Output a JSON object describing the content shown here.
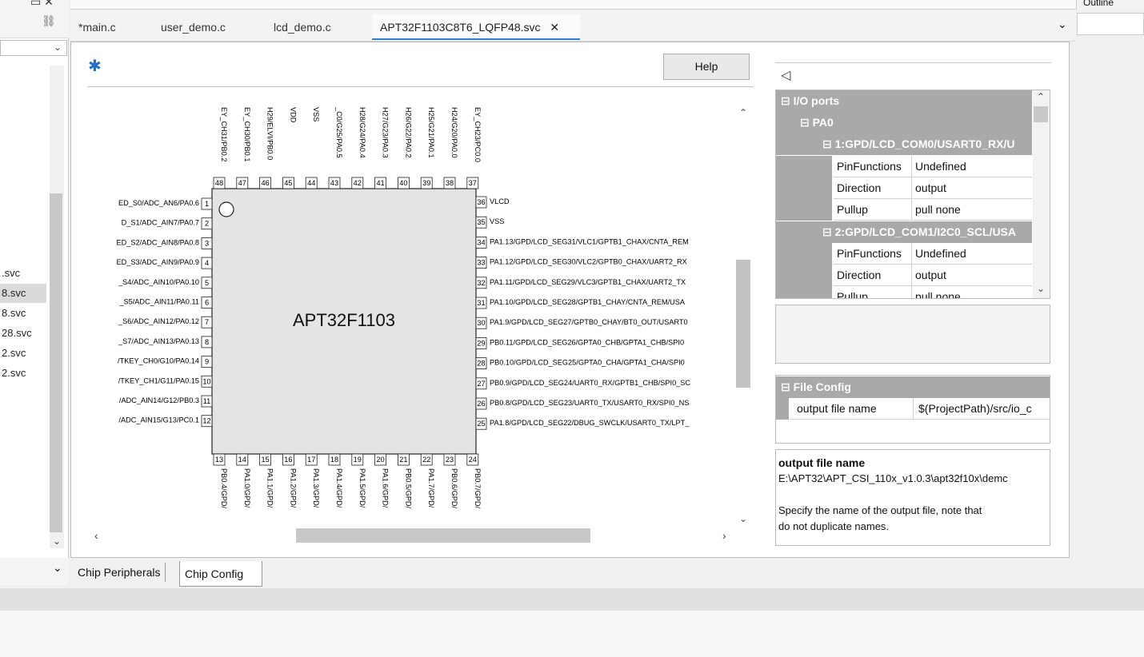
{
  "editor_tabs": [
    {
      "label": "*main.c"
    },
    {
      "label": "user_demo.c"
    },
    {
      "label": "lcd_demo.c"
    },
    {
      "label": "APT32F1103C8T6_LQFP48.svc",
      "active": true
    }
  ],
  "outline_title": "Outline",
  "left_files": [
    ".svc",
    "8.svc",
    "8.svc",
    "28.svc",
    "2.svc",
    "2.svc"
  ],
  "help_label": "Help",
  "chip": {
    "name": "APT32F1103",
    "left_pins": [
      {
        "num": "1",
        "label": "ED_S0/ADC_AN6/PA0.6"
      },
      {
        "num": "2",
        "label": "D_S1/ADC_AIN7/PA0.7"
      },
      {
        "num": "3",
        "label": "ED_S2/ADC_AIN8/PA0.8"
      },
      {
        "num": "4",
        "label": "ED_S3/ADC_AIN9/PA0.9"
      },
      {
        "num": "5",
        "label": "_S4/ADC_AIN10/PA0.10"
      },
      {
        "num": "6",
        "label": "_S5/ADC_AIN11/PA0.11"
      },
      {
        "num": "7",
        "label": "_S6/ADC_AIN12/PA0.12"
      },
      {
        "num": "8",
        "label": "_S7/ADC_AIN13/PA0.13"
      },
      {
        "num": "9",
        "label": "/TKEY_CH0/G10/PA0.14"
      },
      {
        "num": "10",
        "label": "/TKEY_CH1/G11/PA0.15"
      },
      {
        "num": "11",
        "label": "/ADC_AIN14/G12/PB0.3"
      },
      {
        "num": "12",
        "label": "/ADC_AIN15/G13/PC0.1"
      }
    ],
    "right_pins": [
      {
        "num": "36",
        "label": "VLCD"
      },
      {
        "num": "35",
        "label": "VSS"
      },
      {
        "num": "34",
        "label": "PA1.13/GPD/LCD_SEG31/VLC1/GPTB1_CHAX/CNTA_REM"
      },
      {
        "num": "33",
        "label": "PA1.12/GPD/LCD_SEG30/VLC2/GPTB0_CHAX/UART2_RX"
      },
      {
        "num": "32",
        "label": "PA1.11/GPD/LCD_SEG29/VLC3/GPTB1_CHAX/UART2_TX"
      },
      {
        "num": "31",
        "label": "PA1.10/GPD/LCD_SEG28/GPTB1_CHAY/CNTA_REM/USA"
      },
      {
        "num": "30",
        "label": "PA1.9/GPD/LCD_SEG27/GPTB0_CHAY/BT0_OUT/USART0"
      },
      {
        "num": "29",
        "label": "PB0.11/GPD/LCD_SEG26/GPTA0_CHB/GPTA1_CHB/SPI0"
      },
      {
        "num": "28",
        "label": "PB0.10/GPD/LCD_SEG25/GPTA0_CHA/GPTA1_CHA/SPI0"
      },
      {
        "num": "27",
        "label": "PB0.9/GPD/LCD_SEG24/UART0_RX/GPTB1_CHB/SPI0_SC"
      },
      {
        "num": "26",
        "label": "PB0.8/GPD/LCD_SEG23/UART0_TX/USART0_RX/SPI0_NS"
      },
      {
        "num": "25",
        "label": "PA1.8/GPD/LCD_SEG22/DBUG_SWCLK/USART0_TX/LPT_"
      }
    ],
    "top_pins": [
      {
        "num": "48",
        "label": "EY_CH31/PB0.2"
      },
      {
        "num": "47",
        "label": "EY_CH30/PB0.1"
      },
      {
        "num": "46",
        "label": "H29/ELVI/PB0.0"
      },
      {
        "num": "45",
        "label": "VDD"
      },
      {
        "num": "44",
        "label": "VSS"
      },
      {
        "num": "43",
        "label": "_C0/G25/PA0.5"
      },
      {
        "num": "42",
        "label": "H28/G24/PA0.4"
      },
      {
        "num": "41",
        "label": "H27/G23/PA0.3"
      },
      {
        "num": "40",
        "label": "H26/G22/PA0.2"
      },
      {
        "num": "39",
        "label": "H25/G21/PA0.1"
      },
      {
        "num": "38",
        "label": "H24/G20/PA0.0"
      },
      {
        "num": "37",
        "label": "EY_CH23/PC0.0"
      }
    ],
    "bottom_pins": [
      {
        "num": "13",
        "label": "PB0.4/GPD/"
      },
      {
        "num": "14",
        "label": "PA1.0/GPD/"
      },
      {
        "num": "15",
        "label": "PA1.1/GPD/"
      },
      {
        "num": "16",
        "label": "PA1.2/GPD/"
      },
      {
        "num": "17",
        "label": "PA1.3/GPD/"
      },
      {
        "num": "18",
        "label": "PA1.4/GPD/"
      },
      {
        "num": "19",
        "label": "PA1.5/GPD/"
      },
      {
        "num": "20",
        "label": "PA1.6/GPD/"
      },
      {
        "num": "21",
        "label": "PB0.5/GPD/"
      },
      {
        "num": "22",
        "label": "PA1.7/GPD/"
      },
      {
        "num": "23",
        "label": "PB0.6/GPD/"
      },
      {
        "num": "24",
        "label": "PB0.7/GPD/"
      }
    ]
  },
  "io_ports": {
    "category": "I/O ports",
    "port": "PA0",
    "pins": [
      {
        "title": "1:GPD/LCD_COM0/USART0_RX/U",
        "props": [
          {
            "name": "PinFunctions",
            "value": "Undefined"
          },
          {
            "name": "Direction",
            "value": "output"
          },
          {
            "name": "Pullup",
            "value": "pull none"
          }
        ]
      },
      {
        "title": "2:GPD/LCD_COM1/I2C0_SCL/USA",
        "props": [
          {
            "name": "PinFunctions",
            "value": "Undefined"
          },
          {
            "name": "Direction",
            "value": "output"
          },
          {
            "name": "Pullup",
            "value": "pull none"
          }
        ]
      }
    ]
  },
  "file_config": {
    "category": "File Config",
    "name": "output file name",
    "value": "$(ProjectPath)/src/io_c"
  },
  "description": {
    "title": "output file name",
    "path": "E:\\APT32\\APT_CSI_110x_v1.0.3\\apt32f10x\\demc",
    "line1": "Specify the name of the output file, note that",
    "line2": "do not duplicate names."
  },
  "bottom_tabs": [
    "Chip Peripherals",
    "Chip Config"
  ]
}
